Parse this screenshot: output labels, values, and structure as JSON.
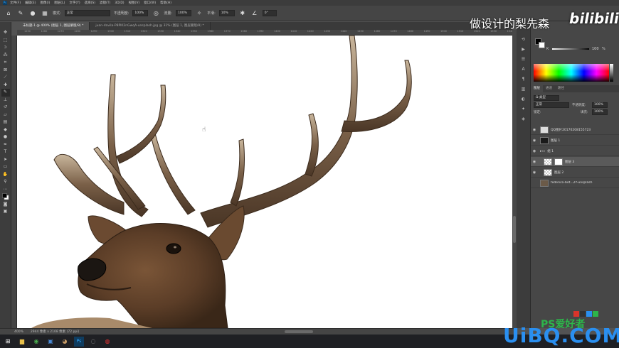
{
  "menubar": {
    "app_icon": "Ps",
    "items": [
      "文件(F)",
      "编辑(E)",
      "图像(I)",
      "图层(L)",
      "文字(Y)",
      "选择(S)",
      "滤镜(T)",
      "3D(D)",
      "视图(V)",
      "窗口(W)",
      "帮助(H)"
    ]
  },
  "options": {
    "mode_label": "模式:",
    "mode_value": "正常",
    "opacity_label": "不透明度:",
    "opacity_value": "100%",
    "flow_label": "流量:",
    "flow_value": "100%",
    "smooth_label": "平滑:",
    "smooth_value": "10%",
    "angle_value": "0°"
  },
  "tabs": [
    {
      "label": "未标题-1 @ 400% (图层 1, 图层蒙版/8) *",
      "active": true
    },
    {
      "label": "juan-davila-P8PlK2nGwqA-unsplash.jpg @ 31% (图层 1, 图层蒙版/8) *",
      "active": false
    }
  ],
  "ruler_ticks": [
    "1250",
    "1260",
    "1270",
    "1280",
    "1290",
    "1300",
    "1310",
    "1320",
    "1330",
    "1340",
    "1350",
    "1360",
    "1370",
    "1380",
    "1390",
    "1400",
    "1410",
    "1420",
    "1430",
    "1440",
    "1450",
    "1460",
    "1470",
    "1480",
    "1490",
    "1500",
    "1510",
    "1520",
    "1530",
    "1540"
  ],
  "status": {
    "zoom": "400%",
    "doc_info": "2944 像素 x 2108 像素 (72 ppi)"
  },
  "color_panel": {
    "k_label": "K",
    "k_value": "100",
    "pct": "%"
  },
  "layers_panel": {
    "tabs": [
      "图层",
      "通道",
      "路径"
    ],
    "kind_label": "Ω 类型",
    "blend_mode": "正常",
    "opacity_label": "不透明度:",
    "opacity_value": "100%",
    "lock_label": "锁定:",
    "fill_label": "填充:",
    "fill_value": "100%",
    "layers": [
      {
        "name": "QQ图片20170208155723",
        "selected": false
      },
      {
        "name": "图层 1",
        "selected": false
      },
      {
        "name": "组 1",
        "selected": false,
        "group": true
      },
      {
        "name": "图层 3",
        "selected": true
      },
      {
        "name": "图层 2",
        "selected": false
      },
      {
        "name": "federico-bot...2Y-unsplash",
        "selected": false
      }
    ]
  },
  "watermark": {
    "channel_text": "做设计的梨先森",
    "bili_text": "bilibili",
    "site_text": "UiBQ.COM",
    "site_sub": "PS爱好者"
  },
  "colors": {
    "menubar": "#3c3c3c",
    "options": "#454545",
    "workspace": "#535353",
    "panel": "#474747",
    "taskbar": "#1f2024",
    "accent": "#2a8ff0"
  }
}
